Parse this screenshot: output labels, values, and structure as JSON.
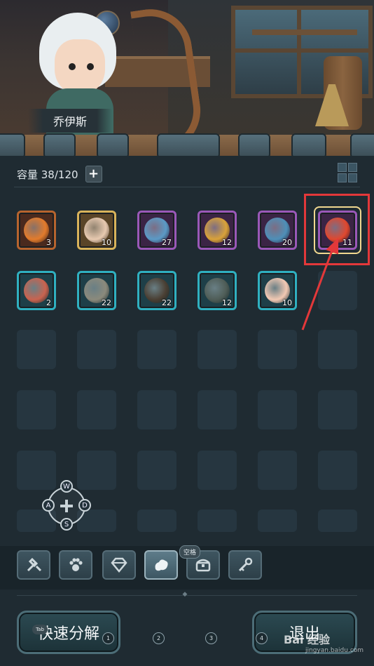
{
  "character": {
    "name": "乔伊斯"
  },
  "inventory": {
    "capacity_label": "容量 38/120",
    "add_label": "+",
    "items": [
      {
        "name": "fire-spirit",
        "count": "3",
        "quality": "orange",
        "color": "#e27b2c"
      },
      {
        "name": "heart-crystal",
        "count": "10",
        "quality": "gold",
        "color": "#e7c9b0"
      },
      {
        "name": "blue-scroll",
        "count": "27",
        "quality": "purple",
        "color": "#5b9ac6"
      },
      {
        "name": "amber-ore",
        "count": "12",
        "quality": "purple",
        "color": "#d9a23a"
      },
      {
        "name": "blue-ore",
        "count": "20",
        "quality": "purple",
        "color": "#4e8fb8"
      },
      {
        "name": "fire-spirit",
        "count": "11",
        "quality": "purple",
        "color": "#e0482f",
        "selected": true
      },
      {
        "name": "meat-leg",
        "count": "2",
        "quality": "teal",
        "color": "#c9634f"
      },
      {
        "name": "ghost-mage-portrait",
        "count": "22",
        "quality": "teal",
        "color": "#8b8a7c"
      },
      {
        "name": "shadow-cat-portrait",
        "count": "22",
        "quality": "teal",
        "color": "#4a3f33"
      },
      {
        "name": "goblin-portrait",
        "count": "12",
        "quality": "teal",
        "color": "#4f5d57"
      },
      {
        "name": "girl-portrait",
        "count": "10",
        "quality": "teal",
        "color": "#f2c9b3"
      }
    ]
  },
  "dpad": {
    "up": "W",
    "left": "A",
    "down": "S",
    "right": "D"
  },
  "tabs": {
    "items": [
      {
        "icon": "tools-icon"
      },
      {
        "icon": "paw-icon"
      },
      {
        "icon": "gem-icon"
      },
      {
        "icon": "material-icon",
        "active": true
      },
      {
        "icon": "chest-icon"
      },
      {
        "icon": "key-icon"
      }
    ],
    "tooltip": "空格"
  },
  "buttons": {
    "dismantle": "快速分解",
    "exit": "退出",
    "tab_key": "Tab"
  },
  "hotkeys": [
    "1",
    "2",
    "3",
    "4"
  ],
  "watermark": {
    "brand": "Bai 经验",
    "url": "jingyan.baidu.com"
  },
  "colors": {
    "background": "#1f2b32",
    "highlight_red": "#e3383a",
    "selection_gold": "#f0d890"
  }
}
